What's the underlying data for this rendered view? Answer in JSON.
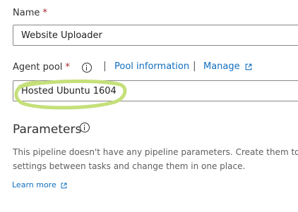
{
  "name_field": {
    "label": "Name",
    "required_marker": "*",
    "value": "Website Uploader"
  },
  "agent_pool": {
    "label": "Agent pool",
    "required_marker": "*",
    "separator": "|",
    "pool_information_link": "Pool information",
    "manage_link": "Manage",
    "value": "Hosted Ubuntu 1604"
  },
  "parameters": {
    "heading": "Parameters",
    "description_line1": "This pipeline doesn't have any pipeline parameters. Create them to",
    "description_line2": "settings between tasks and change them in one place.",
    "learn_more_link": "Learn more"
  },
  "colors": {
    "link": "#106ebe",
    "required": "#a4262c",
    "highlight_annotation": "#c5e07a"
  },
  "icons": {
    "info": "info-circle-icon",
    "external": "external-link-icon"
  }
}
